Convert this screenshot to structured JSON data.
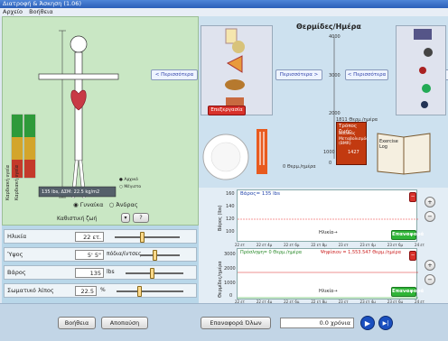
{
  "window": {
    "title": "Διατροφή & Άσκηση (1.06)"
  },
  "menu": [
    "Αρχείο",
    "Βοήθεια"
  ],
  "body": {
    "figure_caption": "135 lbs, ΔΣΜ: 22.5 kg/m2",
    "meter_labels": [
      "Καρδιακή υγεία",
      "Καρδιακή υγεία"
    ],
    "meter_scale": [
      "Αρχικό",
      "Μέγιστο"
    ],
    "gender": {
      "options": [
        "Γυναίκα",
        "Άνδρας"
      ],
      "selected": "Γυναίκα"
    },
    "activity_label": "Καθιστική ζωή",
    "activity_button": "?",
    "activity_arrow": "▾"
  },
  "controls": [
    {
      "label": "Ηλικία",
      "value": "22 ετ.",
      "unit": ""
    },
    {
      "label": "Ύψος",
      "value": "5' 5\"",
      "unit": "πόδια/ίντσες"
    },
    {
      "label": "Βάρος",
      "value": "135",
      "unit": "lbs"
    },
    {
      "label": "Σωματικό λίπος",
      "value": "22.5",
      "unit": "%"
    }
  ],
  "food": {
    "more_left": "< Περισσότερα",
    "more_right": "Περισσότερα >",
    "edit_button": "Επεξεργασία",
    "more_left_2": "< Περισσότερα"
  },
  "calories": {
    "title": "Θερμίδες/Ημέρα",
    "ticks": [
      "4000",
      "3000",
      "2000",
      "1000",
      "0"
    ],
    "intake_label": "0 Θερμ./ημέρα",
    "burn_total": "1811 Θερμ./ημέρα",
    "burn_bar": "Τρόπος ζωής",
    "bmr_label": "Βασικός Μεταβολισμός (BMR)",
    "bmr_value": "1427"
  },
  "exercise": {
    "log_label": "Exercise Log"
  },
  "graph_weight": {
    "title": "Βάρος= 135 lbs",
    "ylabel": "Βάρος (lbs)",
    "xlabel": "Ηλικία",
    "reset": "Επαναφορά",
    "close": "−",
    "yticks": [
      "160",
      "140",
      "120",
      "100"
    ],
    "xticks": [
      "22 ετ",
      "22 ετ 4μ",
      "22 ετ 6μ",
      "22 ετ 8μ",
      "23 ετ",
      "23 ετ 4μ",
      "23 ετ 6μ",
      "24 ετ"
    ]
  },
  "graph_cal": {
    "title_in": "Πρόσληψη= 0 Θερμ./ημέρα",
    "title_out": "Ψηφίσιον = 1,553.547 Θερμ./ημέρα",
    "ylabel": "Θερμίδες/ημέρα",
    "xlabel": "Ηλικία",
    "reset": "Επαναφορά",
    "close": "−",
    "yticks": [
      "3000",
      "2000",
      "1000",
      "0"
    ],
    "xticks": [
      "22 ετ",
      "22 ετ 4μ",
      "22 ετ 6μ",
      "22 ετ 8μ",
      "23 ετ",
      "23 ετ 4μ",
      "23 ετ 6μ",
      "24 ετ"
    ]
  },
  "bottom": {
    "help": "Βοήθεια",
    "pause": "Αποπαύση",
    "reset_all": "Επαναφορά Όλων",
    "time_value": "0.0",
    "time_unit": "χρόνια"
  }
}
